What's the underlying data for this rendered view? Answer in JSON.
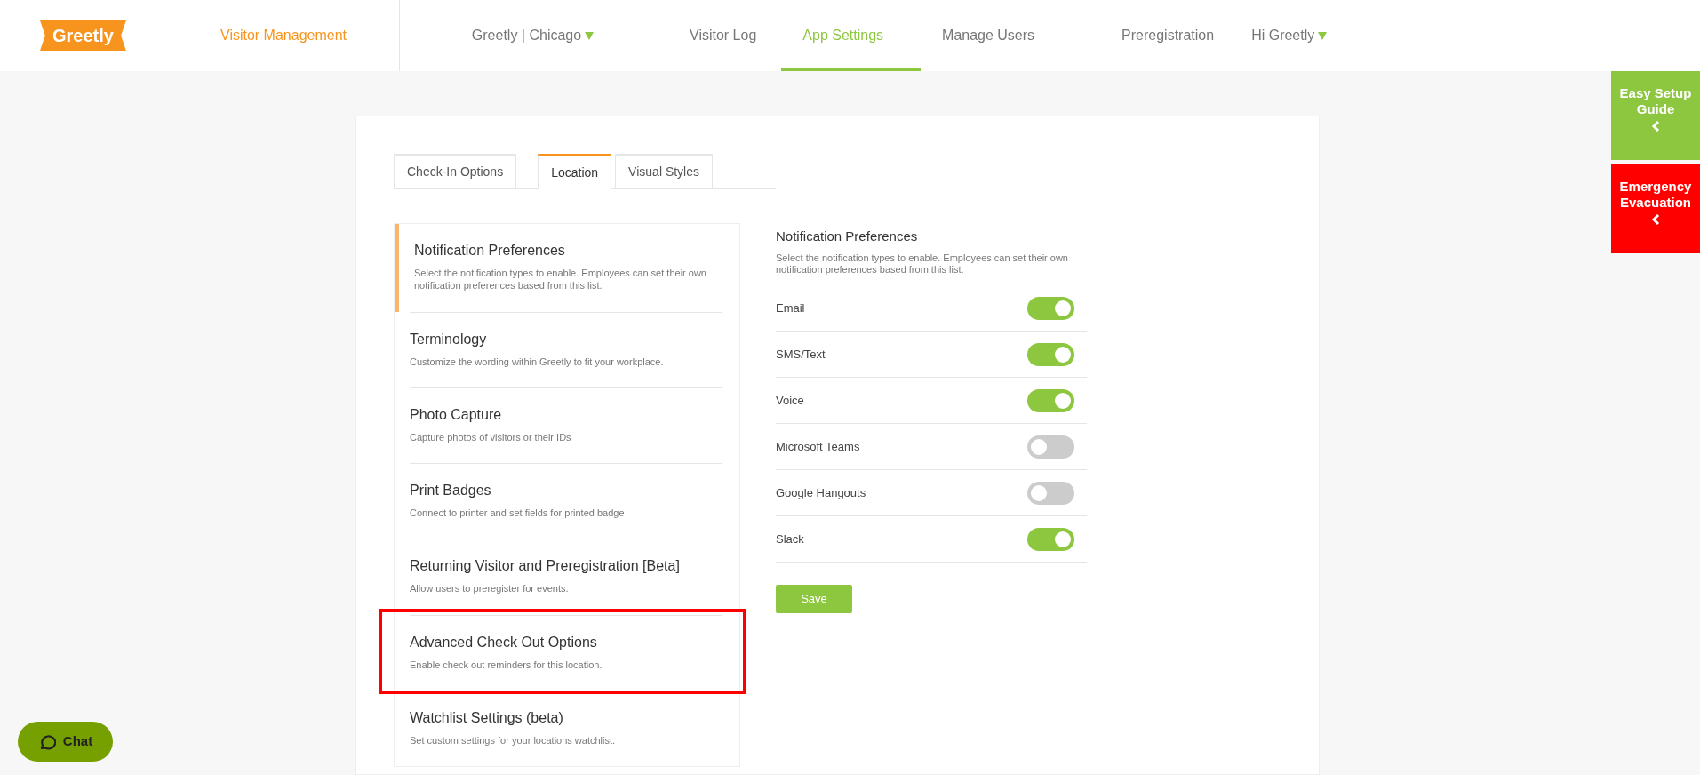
{
  "header": {
    "logo": "Greetly",
    "product_link": "Visitor Management",
    "location_menu": "Greetly | Chicago",
    "nav": [
      {
        "label": "Visitor Log",
        "selected": false
      },
      {
        "label": "App Settings",
        "selected": true
      },
      {
        "label": "Manage Users",
        "selected": false
      },
      {
        "label": "Preregistration",
        "selected": false
      }
    ],
    "user_menu": "Hi Greetly"
  },
  "tabs": [
    {
      "label": "Check-In Options",
      "selected": false
    },
    {
      "label": "Location",
      "selected": true
    },
    {
      "label": "Visual Styles",
      "selected": false
    }
  ],
  "settings_list": [
    {
      "title": "Notification Preferences",
      "description": "Select the notification types to enable. Employees can set their own notification preferences based from this list.",
      "selected": true,
      "highlighted": false
    },
    {
      "title": "Terminology",
      "description": "Customize the wording within Greetly to fit your workplace.",
      "selected": false,
      "highlighted": false
    },
    {
      "title": "Photo Capture",
      "description": "Capture photos of visitors or their IDs",
      "selected": false,
      "highlighted": false
    },
    {
      "title": "Print Badges",
      "description": "Connect to printer and set fields for printed badge",
      "selected": false,
      "highlighted": false
    },
    {
      "title": "Returning Visitor and Preregistration [Beta]",
      "description": "Allow users to preregister for events.",
      "selected": false,
      "highlighted": false
    },
    {
      "title": "Advanced Check Out Options",
      "description": "Enable check out reminders for this location.",
      "selected": false,
      "highlighted": true
    },
    {
      "title": "Watchlist Settings (beta)",
      "description": "Set custom settings for your locations watchlist.",
      "selected": false,
      "highlighted": false
    }
  ],
  "panel": {
    "title": "Notification Preferences",
    "description": "Select the notification types to enable. Employees can set their own notification preferences based from this list.",
    "options": [
      {
        "label": "Email",
        "on": true
      },
      {
        "label": "SMS/Text",
        "on": true
      },
      {
        "label": "Voice",
        "on": true
      },
      {
        "label": "Microsoft Teams",
        "on": false
      },
      {
        "label": "Google Hangouts",
        "on": false
      },
      {
        "label": "Slack",
        "on": true
      }
    ],
    "save_button": "Save"
  },
  "side_buttons": [
    {
      "label": "Easy Setup Guide",
      "kind": "guide"
    },
    {
      "label": "Emergency Evacuation",
      "kind": "emergency"
    }
  ],
  "chat_button": "Chat"
}
